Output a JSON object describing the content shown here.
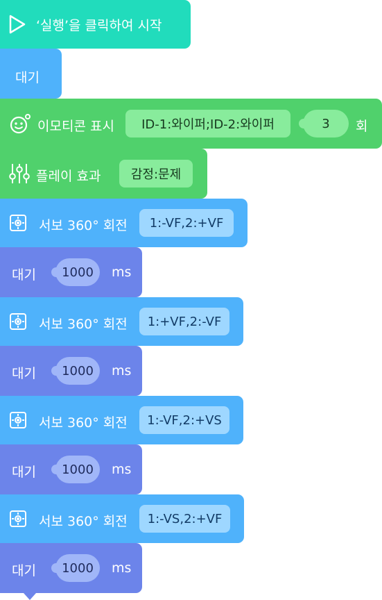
{
  "colors": {
    "event": "#21dcbc",
    "control": "#4fb2fb",
    "looks": "#50d16c",
    "looks_field": "#88ec9c",
    "motion": "#4fb2fb",
    "motion_field": "#9ed7ff",
    "wait": "#6c84ea",
    "wait_field": "#a0b6f8",
    "dark_text": "#173a1f",
    "field_text": "#123b66",
    "wait_text": "#1f2b5c"
  },
  "blocks": {
    "start": {
      "label": "‘실행’을 클릭하여 시작",
      "icon": "play-outline-icon"
    },
    "wait_first": {
      "label": "대기"
    },
    "emoticon": {
      "label": "이모티콘 표시",
      "value": "ID-1:와이퍼;ID-2:와이퍼",
      "count": "3",
      "suffix": "회",
      "icon": "smiley-icon"
    },
    "play_effect": {
      "label": "플레이 효과",
      "value": "감정:문제",
      "icon": "equalizer-icon"
    },
    "servo_rotations": [
      {
        "label": "서보 360° 회전",
        "value": "1:-VF,2:+VF",
        "icon": "servo-icon"
      },
      {
        "label": "서보 360° 회전",
        "value": "1:+VF,2:-VF",
        "icon": "servo-icon"
      },
      {
        "label": "서보 360° 회전",
        "value": "1:-VF,2:+VS",
        "icon": "servo-icon"
      },
      {
        "label": "서보 360° 회전",
        "value": "1:-VS,2:+VF",
        "icon": "servo-icon"
      }
    ],
    "waits": [
      {
        "label": "대기",
        "value": "1000",
        "unit": "ms"
      },
      {
        "label": "대기",
        "value": "1000",
        "unit": "ms"
      },
      {
        "label": "대기",
        "value": "1000",
        "unit": "ms"
      },
      {
        "label": "대기",
        "value": "1000",
        "unit": "ms"
      }
    ]
  }
}
